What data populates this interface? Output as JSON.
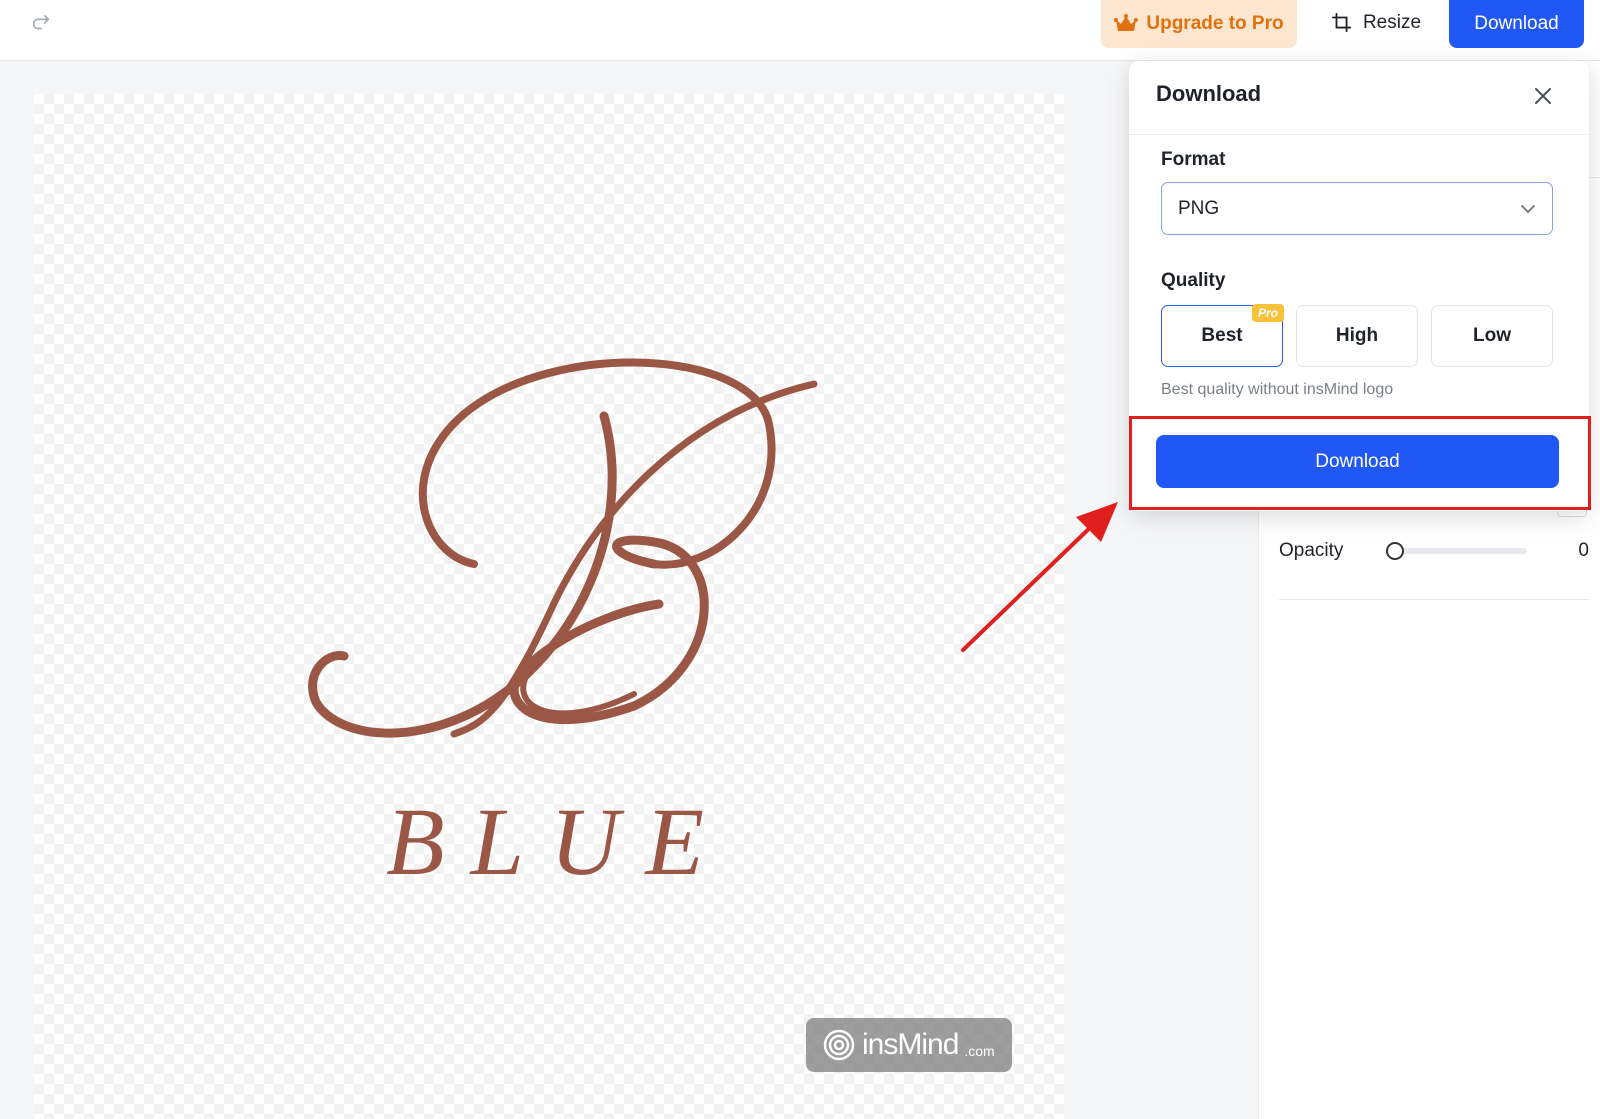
{
  "topbar": {
    "redo_icon": "redo-icon",
    "upgrade_label": "Upgrade to Pro",
    "upgrade_icon": "crown-icon",
    "resize_label": "Resize",
    "resize_icon": "crop-icon",
    "download_label": "Download"
  },
  "canvas": {
    "artwork_text": "BLUE",
    "watermark": {
      "name": "insMind",
      "tld": ".com"
    }
  },
  "right_panel": {
    "opacity_label": "Opacity",
    "opacity_value": "0",
    "opacity_fraction": 0
  },
  "download_popover": {
    "title": "Download",
    "close_icon": "close-icon",
    "format_label": "Format",
    "format_value": "PNG",
    "quality_label": "Quality",
    "quality_options": [
      {
        "label": "Best",
        "selected": true,
        "badge": "Pro"
      },
      {
        "label": "High",
        "selected": false
      },
      {
        "label": "Low",
        "selected": false
      }
    ],
    "quality_hint": "Best quality without insMind logo",
    "download_button": "Download"
  },
  "colors": {
    "accent_blue": "#2158f5",
    "upgrade_text": "#e0720e",
    "upgrade_bg": "#fde6cf",
    "logo_brown": "#9b5746",
    "annotation_red": "#e0201e",
    "pro_badge": "#f7c23a"
  }
}
